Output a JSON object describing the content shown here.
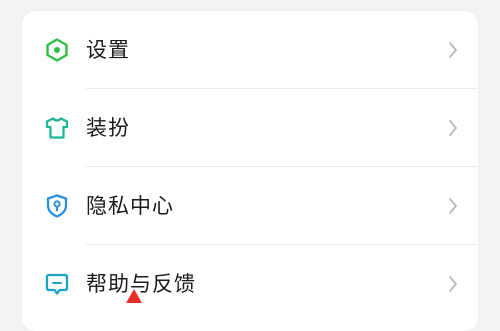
{
  "menu": {
    "items": [
      {
        "label": "设置",
        "icon": "settings-hexagon-icon",
        "color": "#2fbf43"
      },
      {
        "label": "装扮",
        "icon": "tshirt-icon",
        "color": "#1fb79a"
      },
      {
        "label": "隐私中心",
        "icon": "privacy-shield-icon",
        "color": "#2a8fe0"
      },
      {
        "label": "帮助与反馈",
        "icon": "feedback-chat-icon",
        "color": "#1aa3c8"
      }
    ]
  },
  "colors": {
    "background": "#f1f2f4",
    "card": "#ffffff",
    "text": "#1b1b1b",
    "chevron": "#b8b8bb",
    "cursor": "#e5302a"
  }
}
